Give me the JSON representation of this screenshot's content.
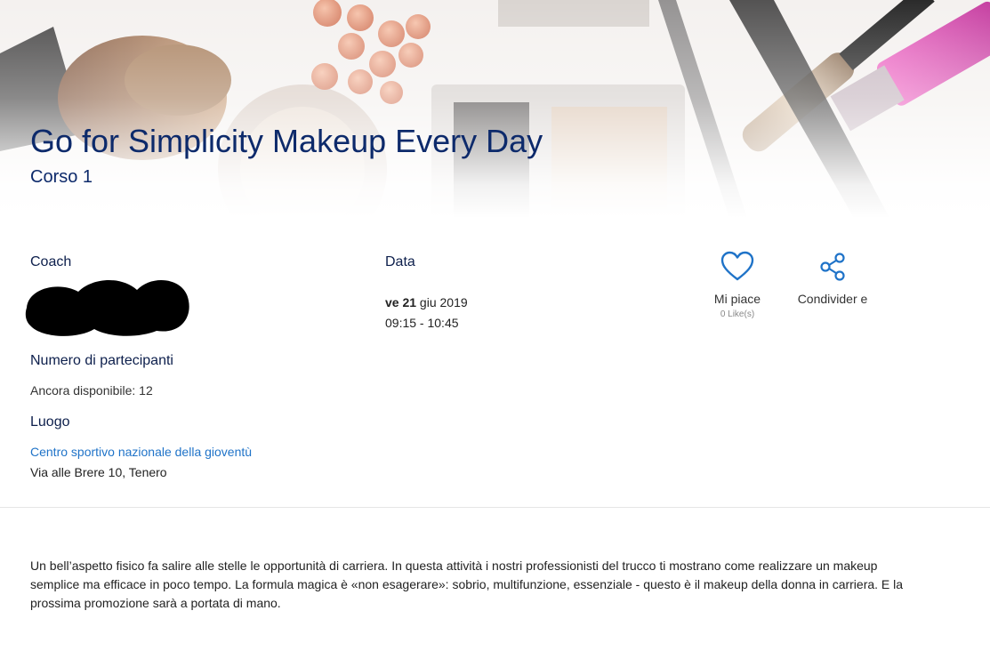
{
  "hero": {
    "title": "Go for Simplicity Makeup Every Day",
    "subtitle": "Corso 1"
  },
  "coach": {
    "label": "Coach"
  },
  "participants": {
    "label": "Numero di partecipanti",
    "availability": "Ancora disponibile: 12"
  },
  "location": {
    "label": "Luogo",
    "venue_link": "Centro sportivo nazionale della gioventù",
    "address": "Via alle Brere 10, Tenero"
  },
  "date": {
    "label": "Data",
    "day_prefix": "ve 21",
    "day_suffix": " giu 2019",
    "time": "09:15 - 10:45"
  },
  "actions": {
    "like_label": "Mi piace",
    "like_count": "0 Like(s)",
    "share_label": "Condivider e",
    "accent_color": "#1f73c8"
  },
  "description": "Un bell’aspetto fisico fa salire alle stelle le opportunità di carriera. In questa attività i nostri professionisti del trucco ti mostrano come realizzare un makeup semplice ma efficace in poco tempo. La formula magica è «non esagerare»: sobrio, multifunzione, essenziale - questo è il makeup della donna in carriera. E la prossima promozione sarà a portata di mano."
}
